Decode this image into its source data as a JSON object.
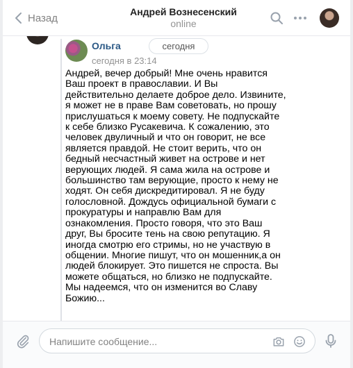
{
  "header": {
    "back_label": "Назад",
    "title": "Андрей Вознесенский",
    "status": "online",
    "icons": [
      "chevron-left-icon",
      "search-icon",
      "more-icon"
    ]
  },
  "forwarded": {
    "sender": "Ольга",
    "time": "сегодня в 23:14",
    "date_pill": "сегодня",
    "text": "Андрей, вечер добрый! Мне очень нравится\nВаш проект в православии. И Вы\nдействительно делаете доброе дело. Извините,\nя может не в праве Вам советовать, но прошу\nприслушаться к моему совету. Не подпускайте\nк себе близко Русакевича. К сожалению, это\nчеловек двуличный и что он говорит, не все\nявляется правдой. Не стоит верить, что он\nбедный несчастный живет на острове и нет\nверующих людей. Я сама жила на острове и\nбольшинство там верующие, просто к нему не\nходят. Он себя дискредитировал. Я не буду\nголословной. Дождусь официальной бумаги с\nпрокуратуры и направлю Вам для\nознакомления. Просто говоря, что это Ваш\nдруг, Вы бросите тень на свою репутацию. Я\nиногда смотрю его стримы, но не участвую в\nобщении. Многие пишут, что он мошенник,а он\nлюдей блокирует. Это пишется не спроста. Вы\nможете общаться, но близко не подпускайте.\nМы надеемся, что он изменится во Славу\nБожию..."
  },
  "composer": {
    "placeholder": "Напишите сообщение...",
    "value": ""
  },
  "colors": {
    "link": "#2a5885",
    "accent": "#5181b8",
    "muted": "#939393"
  }
}
